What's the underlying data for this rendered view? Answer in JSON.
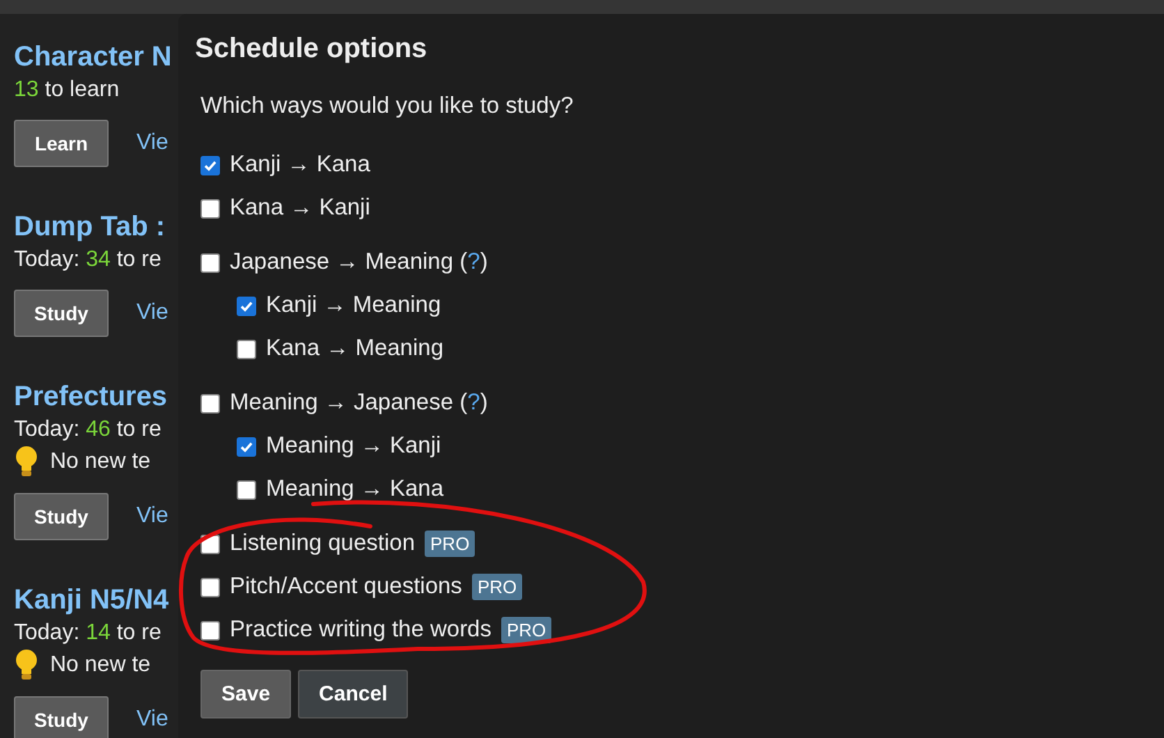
{
  "background_cards": [
    {
      "title": "Character N",
      "count": "13",
      "stat_suffix": " to learn",
      "button": "Learn",
      "link": "Vie"
    },
    {
      "title": "Dump Tab :",
      "count": "34",
      "stat_prefix": "Today: ",
      "stat_suffix": " to re",
      "button": "Study",
      "link": "Vie"
    },
    {
      "title": "Prefectures",
      "count": "46",
      "stat_prefix": "Today: ",
      "stat_suffix": " to re",
      "tip": "No new te",
      "button": "Study",
      "link": "Vie"
    },
    {
      "title": "Kanji N5/N4",
      "count": "14",
      "stat_prefix": "Today: ",
      "stat_suffix": " to re",
      "tip": "No new te",
      "button": "Study",
      "link": "Vie"
    }
  ],
  "dialog": {
    "title": "Schedule options",
    "question": "Which ways would you like to study?",
    "options": [
      {
        "label": "Kanji → Kana",
        "checked": true
      },
      {
        "label": "Kana → Kanji",
        "checked": false
      },
      {
        "label": "Japanese → Meaning",
        "checked": false,
        "help": {
          "before": "(",
          "link": "?",
          "after": ")"
        },
        "children": [
          {
            "label": "Kanji → Meaning",
            "checked": true
          },
          {
            "label": "Kana → Meaning",
            "checked": false
          }
        ]
      },
      {
        "label": "Meaning → Japanese",
        "checked": false,
        "help": {
          "before": "(",
          "link": "?",
          "after": ")"
        },
        "children": [
          {
            "label": "Meaning → Kanji",
            "checked": true
          },
          {
            "label": "Meaning → Kana",
            "checked": false
          }
        ]
      },
      {
        "label": "Listening question",
        "checked": false,
        "badge": "PRO"
      },
      {
        "label": "Pitch/Accent questions",
        "checked": false,
        "badge": "PRO"
      },
      {
        "label": "Practice writing the words",
        "checked": false,
        "badge": "PRO"
      }
    ],
    "buttons": [
      {
        "label": "Save",
        "kind": "primary"
      },
      {
        "label": "Cancel",
        "kind": "secondary"
      }
    ]
  }
}
